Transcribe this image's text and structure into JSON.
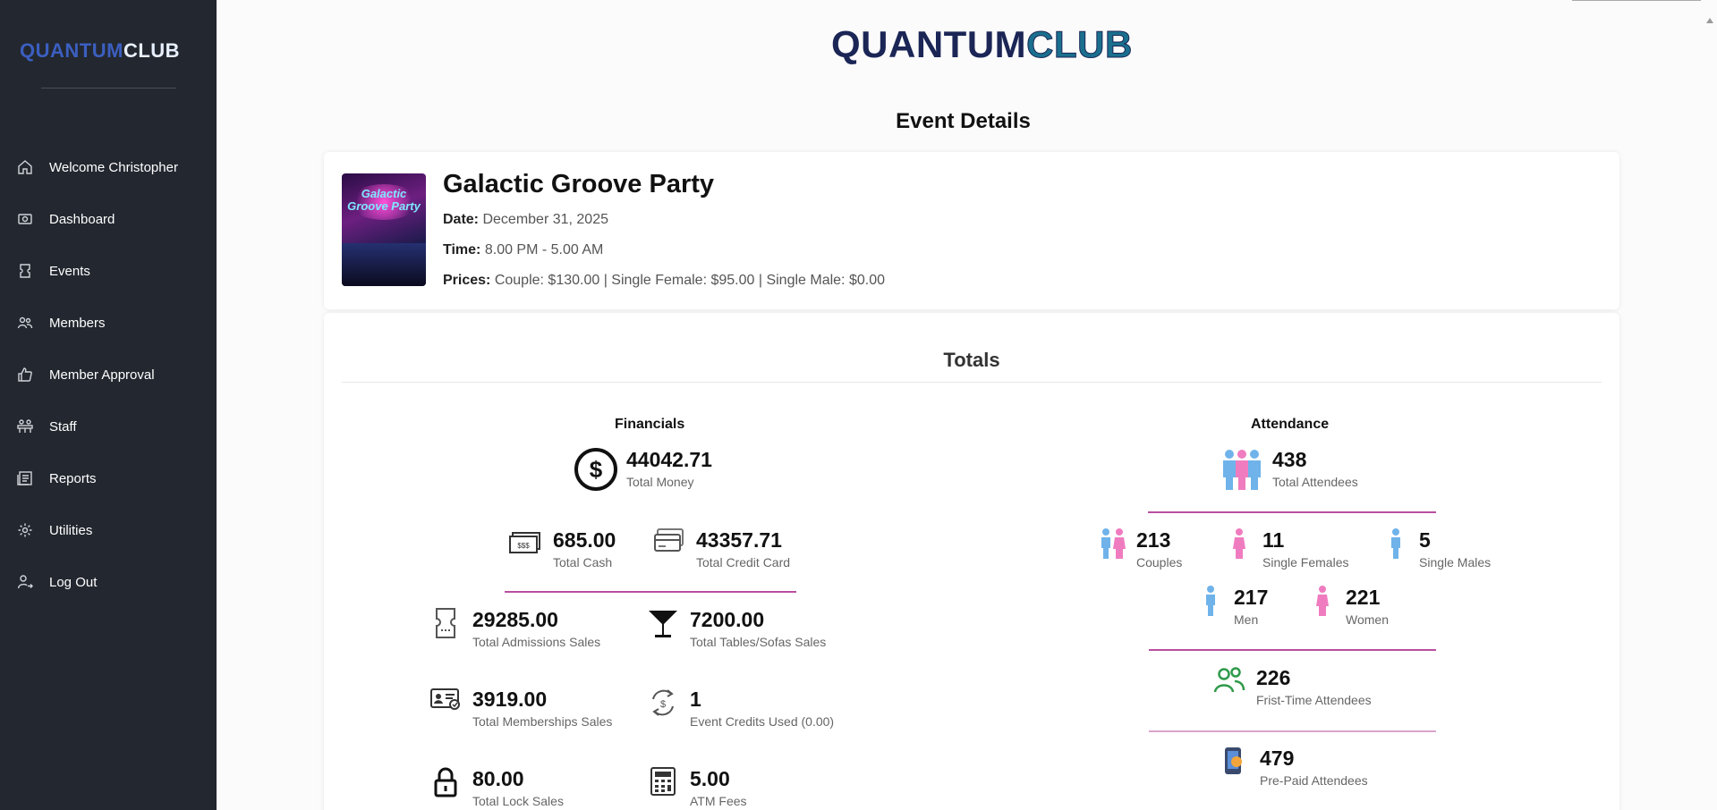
{
  "sidebar": {
    "logo": {
      "part1": "QUANTUM",
      "part2": "CLUB"
    },
    "items": [
      {
        "label": "Welcome Christopher",
        "icon": "home-icon"
      },
      {
        "label": "Dashboard",
        "icon": "dashboard-icon"
      },
      {
        "label": "Events",
        "icon": "ticket-icon"
      },
      {
        "label": "Members",
        "icon": "members-icon"
      },
      {
        "label": "Member Approval",
        "icon": "thumbs-up-icon"
      },
      {
        "label": "Staff",
        "icon": "staff-icon"
      },
      {
        "label": "Reports",
        "icon": "reports-icon"
      },
      {
        "label": "Utilities",
        "icon": "gear-icon"
      },
      {
        "label": "Log Out",
        "icon": "logout-icon"
      }
    ]
  },
  "header": {
    "logo": {
      "part1": "QUANTUM",
      "part2": "CLUB"
    },
    "title": "Event Details"
  },
  "event": {
    "poster_text": "Galactic Groove Party",
    "name": "Galactic Groove Party",
    "date_label": "Date:",
    "date": "December 31, 2025",
    "time_label": "Time:",
    "time": "8.00 PM - 5.00 AM",
    "prices_label": "Prices:",
    "prices": "Couple: $130.00 | Single Female: $95.00 | Single Male: $0.00"
  },
  "totals": {
    "title": "Totals",
    "financials": {
      "heading": "Financials",
      "total_money": {
        "value": "44042.71",
        "label": "Total Money"
      },
      "total_cash": {
        "value": "685.00",
        "label": "Total Cash"
      },
      "total_credit": {
        "value": "43357.71",
        "label": "Total Credit Card"
      },
      "admissions": {
        "value": "29285.00",
        "label": "Total Admissions Sales"
      },
      "tables": {
        "value": "7200.00",
        "label": "Total Tables/Sofas Sales"
      },
      "memberships": {
        "value": "3919.00",
        "label": "Total Memberships Sales"
      },
      "credits": {
        "value": "1",
        "label": "Event Credits Used (0.00)"
      },
      "lock": {
        "value": "80.00",
        "label": "Total Lock Sales"
      },
      "atm": {
        "value": "5.00",
        "label": "ATM Fees"
      }
    },
    "attendance": {
      "heading": "Attendance",
      "total": {
        "value": "438",
        "label": "Total Attendees"
      },
      "couples": {
        "value": "213",
        "label": "Couples"
      },
      "single_females": {
        "value": "11",
        "label": "Single Females"
      },
      "single_males": {
        "value": "5",
        "label": "Single Males"
      },
      "men": {
        "value": "217",
        "label": "Men"
      },
      "women": {
        "value": "221",
        "label": "Women"
      },
      "first_time": {
        "value": "226",
        "label": "Frist-Time Attendees"
      },
      "prepaid": {
        "value": "479",
        "label": "Pre-Paid Attendees"
      }
    }
  },
  "colors": {
    "sidebar_bg": "#23272f",
    "accent_pink": "#b84fa0",
    "male_blue": "#6fb3ea",
    "female_pink": "#f07cc0",
    "green": "#2e9a4a"
  }
}
